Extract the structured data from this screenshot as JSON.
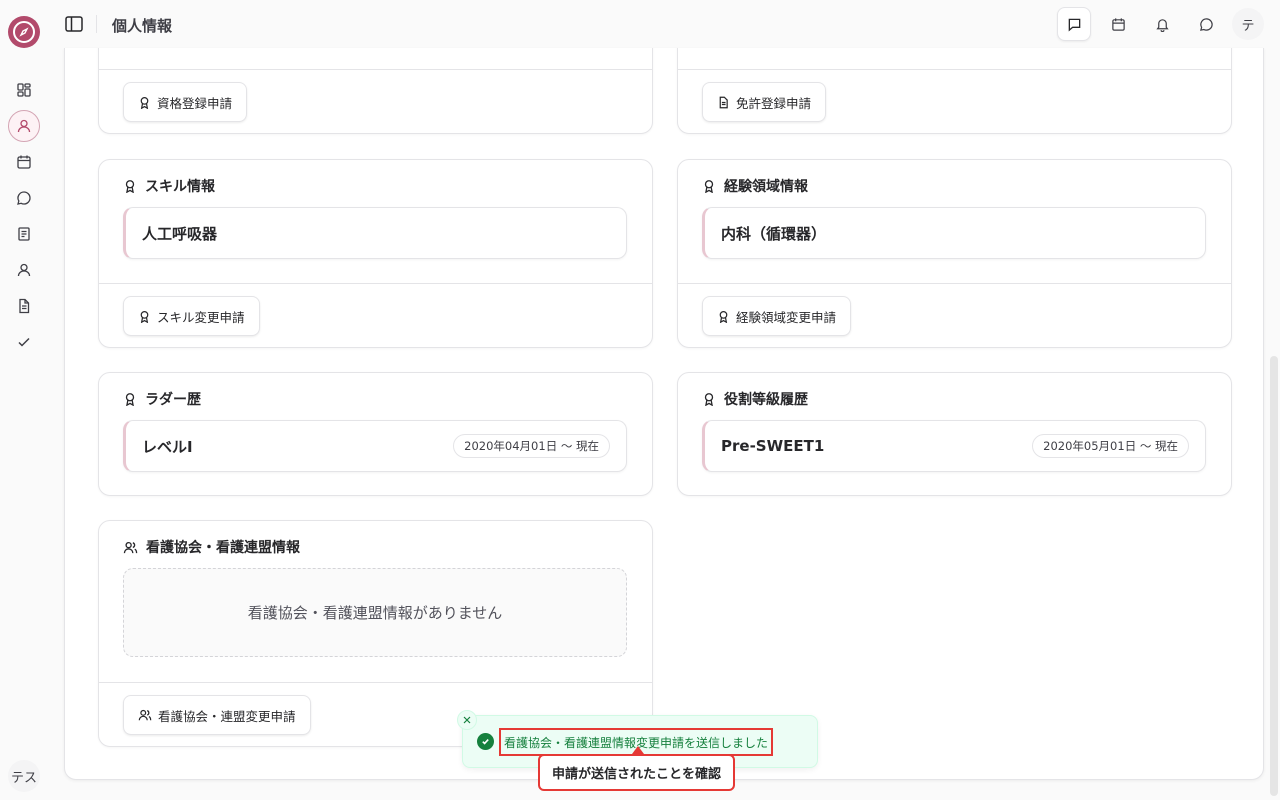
{
  "header": {
    "title": "個人情報",
    "user_initial": "テ"
  },
  "rail": {
    "user_initial": "テス"
  },
  "cards": {
    "qualification": {
      "button_label": "資格登録申請"
    },
    "license": {
      "button_label": "免許登録申請"
    },
    "skill": {
      "title": "スキル情報",
      "items": [
        "人工呼吸器"
      ],
      "button_label": "スキル変更申請"
    },
    "experience": {
      "title": "経験領域情報",
      "items": [
        "内科（循環器）"
      ],
      "button_label": "経験領域変更申請"
    },
    "ladder": {
      "title": "ラダー歴",
      "items": [
        {
          "label": "レベルI",
          "period": "2020年04月01日 〜 現在"
        }
      ]
    },
    "role_grade": {
      "title": "役割等級履歴",
      "items": [
        {
          "label": "Pre-SWEET1",
          "period": "2020年05月01日 〜 現在"
        }
      ]
    },
    "nursing_assoc": {
      "title": "看護協会・看護連盟情報",
      "empty_text": "看護協会・看護連盟情報がありません",
      "button_label": "看護協会・連盟変更申請"
    }
  },
  "toast": {
    "message": "看護協会・看護連盟情報変更申請を送信しました",
    "status": "success"
  },
  "annotation": {
    "callout": "申請が送信されたことを確認"
  },
  "colors": {
    "brand": "#b24a6b",
    "success": "#15803d",
    "annotation": "#e53935"
  }
}
